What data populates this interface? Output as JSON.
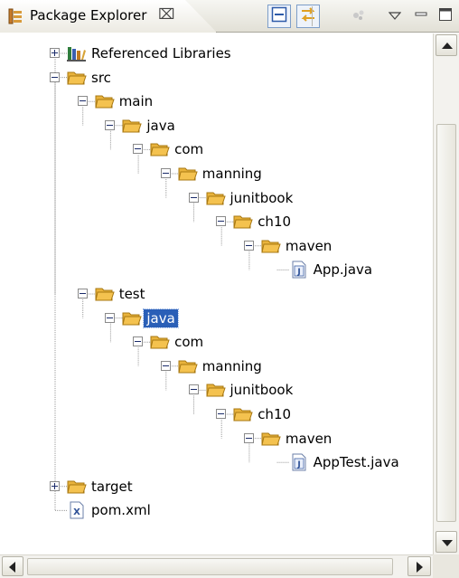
{
  "view": {
    "title": "Package Explorer",
    "close_glyph": "⌧",
    "toolbar": {
      "collapse_all_icon": "collapse-all-icon",
      "link_with_editor_icon": "link-with-editor-icon",
      "filters_icon": "filters-icon",
      "view_menu_icon": "view-menu-icon",
      "minimize_icon": "minimize-icon",
      "maximize_icon": "maximize-icon"
    }
  },
  "colors": {
    "selection": "#2a5fb7",
    "folder": "#f4c24f",
    "tree_line": "#9a9a9a"
  },
  "tree": [
    {
      "label": "Referenced Libraries",
      "depth": 0,
      "toggle": "plus",
      "icon": "library-icon"
    },
    {
      "label": "src",
      "depth": 0,
      "toggle": "minus",
      "icon": "folder-icon"
    },
    {
      "label": "main",
      "depth": 1,
      "toggle": "minus",
      "icon": "folder-icon"
    },
    {
      "label": "java",
      "depth": 2,
      "toggle": "minus",
      "icon": "folder-icon"
    },
    {
      "label": "com",
      "depth": 3,
      "toggle": "minus",
      "icon": "folder-icon"
    },
    {
      "label": "manning",
      "depth": 4,
      "toggle": "minus",
      "icon": "folder-icon"
    },
    {
      "label": "junitbook",
      "depth": 5,
      "toggle": "minus",
      "icon": "folder-icon"
    },
    {
      "label": "ch10",
      "depth": 6,
      "toggle": "minus",
      "icon": "folder-icon"
    },
    {
      "label": "maven",
      "depth": 7,
      "toggle": "minus",
      "icon": "folder-icon"
    },
    {
      "label": "App.java",
      "depth": 8,
      "toggle": "none",
      "icon": "java-file-icon"
    },
    {
      "label": "test",
      "depth": 1,
      "toggle": "minus",
      "icon": "folder-icon"
    },
    {
      "label": "java",
      "depth": 2,
      "toggle": "minus",
      "icon": "folder-icon",
      "selected": true
    },
    {
      "label": "com",
      "depth": 3,
      "toggle": "minus",
      "icon": "folder-icon"
    },
    {
      "label": "manning",
      "depth": 4,
      "toggle": "minus",
      "icon": "folder-icon"
    },
    {
      "label": "junitbook",
      "depth": 5,
      "toggle": "minus",
      "icon": "folder-icon"
    },
    {
      "label": "ch10",
      "depth": 6,
      "toggle": "minus",
      "icon": "folder-icon"
    },
    {
      "label": "maven",
      "depth": 7,
      "toggle": "minus",
      "icon": "folder-icon"
    },
    {
      "label": "AppTest.java",
      "depth": 8,
      "toggle": "none",
      "icon": "java-file-icon"
    },
    {
      "label": "target",
      "depth": 0,
      "toggle": "plus",
      "icon": "folder-icon"
    },
    {
      "label": "pom.xml",
      "depth": 0,
      "toggle": "none",
      "icon": "xml-file-icon"
    }
  ]
}
